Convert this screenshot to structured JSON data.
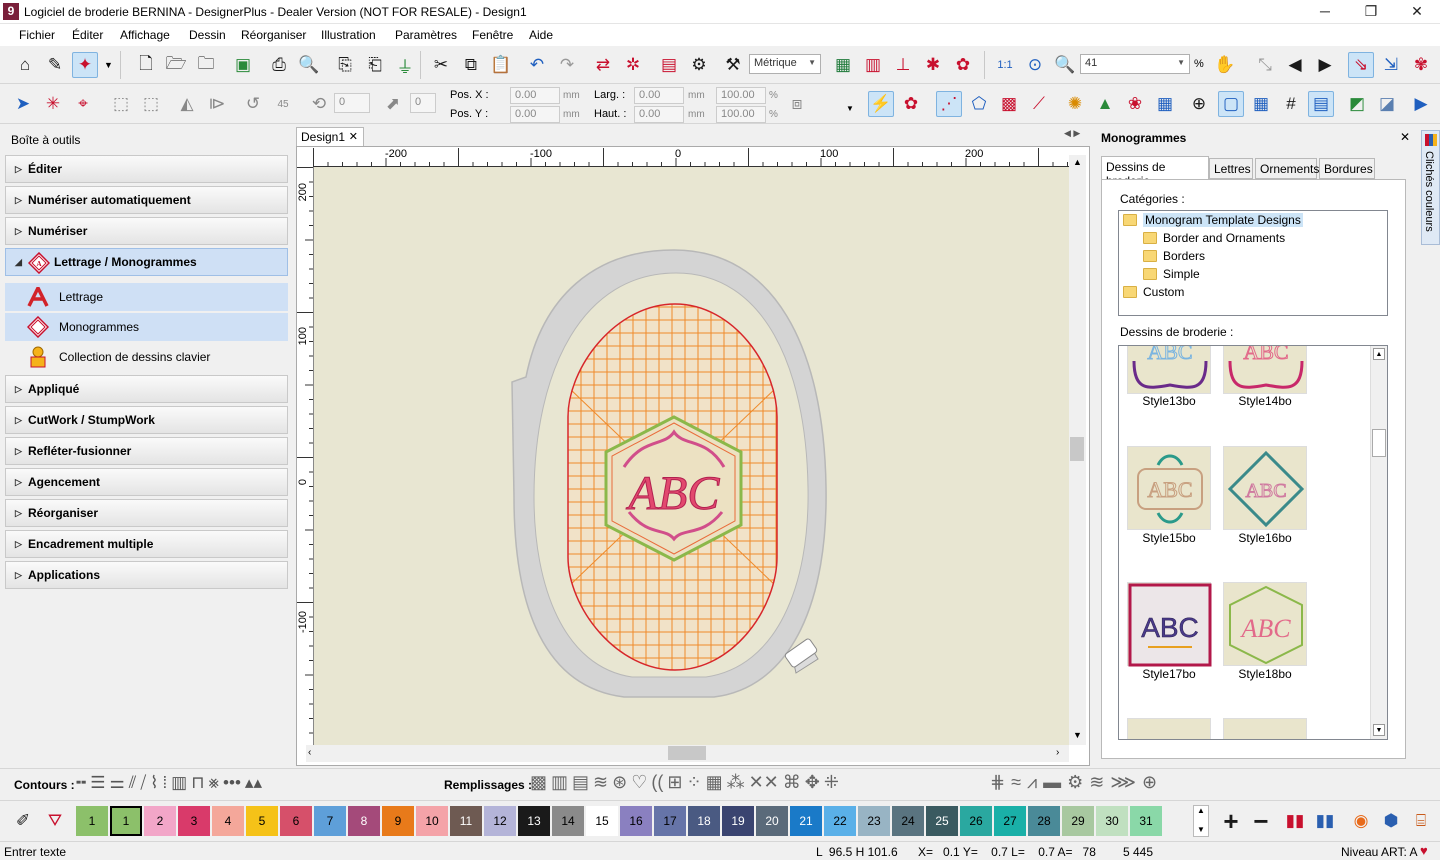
{
  "window": {
    "title": "Logiciel de broderie BERNINA - DesignerPlus - Dealer Version (NOT FOR RESALE) - Design1",
    "app_icon": "9",
    "controls": [
      "─",
      "❐",
      "✕"
    ]
  },
  "menu": [
    "Fichier",
    "Éditer",
    "Affichage",
    "Dessin",
    "Réorganiser",
    "Illustration",
    "Paramètres",
    "Fenêtre",
    "Aide"
  ],
  "toolbar1": {
    "units_value": "Métrique",
    "zoom_value": "41",
    "zoom_unit": "%",
    "zoom_one_to_one": "1:1"
  },
  "toolbar2": {
    "rotate_value": "0",
    "slant_value": "0",
    "rotate_45_label": "45",
    "pos_x_label": "Pos. X :",
    "pos_y_label": "Pos. Y :",
    "pos_x_value": "0.00",
    "pos_y_value": "0.00",
    "larg_label": "Larg. :",
    "haut_label": "Haut. :",
    "larg_value": "0.00",
    "haut_value": "0.00",
    "pct_w": "100.00",
    "pct_h": "100.00",
    "mm": "mm",
    "pct": "%"
  },
  "toolbox": {
    "title": "Boîte à outils",
    "sections": [
      "Éditer",
      "Numériser automatiquement",
      "Numériser"
    ],
    "open_section": "Lettrage / Monogrammes",
    "open_items": [
      "Lettrage",
      "Monogrammes",
      "Collection de dessins clavier"
    ],
    "sections_after": [
      "Appliqué",
      "CutWork / StumpWork",
      "Refléter-fusionner",
      "Agencement",
      "Réorganiser",
      "Encadrement multiple",
      "Applications"
    ]
  },
  "document": {
    "tab_label": "Design1",
    "tab_close": "✕",
    "ruler_h": [
      "-200",
      "-100",
      "0",
      "100",
      "200"
    ],
    "ruler_v": [
      "200",
      "100",
      "0",
      "-100"
    ],
    "monogram_text": "ABC"
  },
  "right_panel": {
    "title": "Monogrammes",
    "tabs": [
      "Dessins de broderie",
      "Lettres",
      "Ornements",
      "Bordures"
    ],
    "categories_label": "Catégories :",
    "categories": [
      {
        "label": "Monogram Template Designs",
        "level": 0,
        "selected": true
      },
      {
        "label": "Border and Ornaments",
        "level": 1
      },
      {
        "label": "Borders",
        "level": 1
      },
      {
        "label": "Simple",
        "level": 1
      },
      {
        "label": "Custom",
        "level": 0
      }
    ],
    "designs_label": "Dessins de broderie :",
    "designs": [
      "Style13bo",
      "Style14bo",
      "Style15bo",
      "Style16bo",
      "Style17bo",
      "Style18bo"
    ],
    "thumb_text": "ABC",
    "side_tab": "Clichés couleurs"
  },
  "stitch_bar": {
    "contours_label": "Contours :",
    "fills_label": "Remplissages :"
  },
  "colors": {
    "swatches": [
      {
        "n": "1",
        "c": "#8cc06a"
      },
      {
        "n": "1",
        "c": "#8cc06a"
      },
      {
        "n": "2",
        "c": "#f2a6c8"
      },
      {
        "n": "3",
        "c": "#d93a6a"
      },
      {
        "n": "4",
        "c": "#f4a79a"
      },
      {
        "n": "5",
        "c": "#f5c218"
      },
      {
        "n": "6",
        "c": "#d6506a"
      },
      {
        "n": "7",
        "c": "#5e9fd9"
      },
      {
        "n": "8",
        "c": "#a44a7a"
      },
      {
        "n": "9",
        "c": "#e87a1a"
      },
      {
        "n": "10",
        "c": "#f4a3a8"
      },
      {
        "n": "11",
        "c": "#6e5a52"
      },
      {
        "n": "12",
        "c": "#b4b4d8"
      },
      {
        "n": "13",
        "c": "#1a1a1a"
      },
      {
        "n": "14",
        "c": "#8a8a8a"
      },
      {
        "n": "15",
        "c": "#ffffff"
      },
      {
        "n": "16",
        "c": "#8a80c0"
      },
      {
        "n": "17",
        "c": "#6674a8"
      },
      {
        "n": "18",
        "c": "#4a5a82"
      },
      {
        "n": "19",
        "c": "#3a4470"
      },
      {
        "n": "20",
        "c": "#5a6a7a"
      },
      {
        "n": "21",
        "c": "#1a7ac8"
      },
      {
        "n": "22",
        "c": "#5ab0e8"
      },
      {
        "n": "23",
        "c": "#98b4c4"
      },
      {
        "n": "24",
        "c": "#5a7480"
      },
      {
        "n": "25",
        "c": "#3a5a60"
      },
      {
        "n": "26",
        "c": "#2aa8a0"
      },
      {
        "n": "27",
        "c": "#1ab0a8"
      },
      {
        "n": "28",
        "c": "#4a8a98"
      },
      {
        "n": "29",
        "c": "#a8c8a0"
      },
      {
        "n": "30",
        "c": "#c0e0c0"
      },
      {
        "n": "31",
        "c": "#8ad8a8"
      }
    ]
  },
  "status": {
    "left": "Entrer texte",
    "dims": "L  96.5 H 101.6",
    "coords": "X=   0.1 Y=    0.7 L=    0.7 A=   78",
    "stitches": "5 445",
    "level": "Niveau ART: A"
  }
}
